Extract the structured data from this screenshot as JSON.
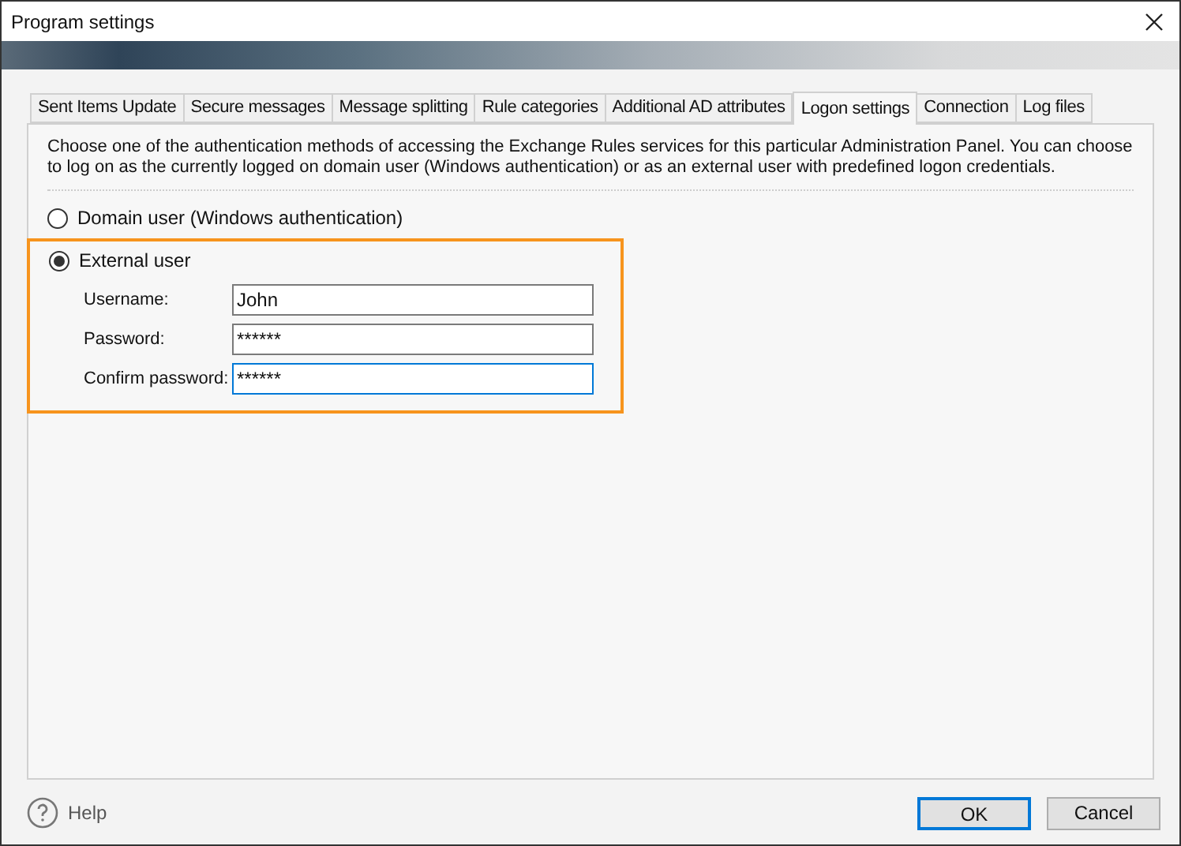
{
  "window": {
    "title": "Program settings"
  },
  "tabs": [
    {
      "label": "Sent Items Update",
      "selected": false
    },
    {
      "label": "Secure messages",
      "selected": false
    },
    {
      "label": "Message splitting",
      "selected": false
    },
    {
      "label": "Rule categories",
      "selected": false
    },
    {
      "label": "Additional AD attributes",
      "selected": false
    },
    {
      "label": "Logon settings",
      "selected": true
    },
    {
      "label": "Connection",
      "selected": false
    },
    {
      "label": "Log files",
      "selected": false
    }
  ],
  "description": "Choose one of the authentication methods of accessing the Exchange Rules services for this particular Administration Panel. You can choose to log on as the currently logged on domain user (Windows authentication) or as an external user with predefined logon credentials.",
  "options": [
    {
      "label": "Domain user (Windows authentication)",
      "selected": false
    },
    {
      "label": "External user",
      "selected": true
    }
  ],
  "fields": [
    {
      "label": "Username:",
      "value": "John",
      "focused": false
    },
    {
      "label": "Password:",
      "value": "******",
      "focused": false
    },
    {
      "label": "Confirm password:",
      "value": "******",
      "focused": true
    }
  ],
  "footer": {
    "help": "Help",
    "buttons": [
      {
        "label": "OK",
        "default": true
      },
      {
        "label": "Cancel",
        "default": false
      }
    ]
  }
}
